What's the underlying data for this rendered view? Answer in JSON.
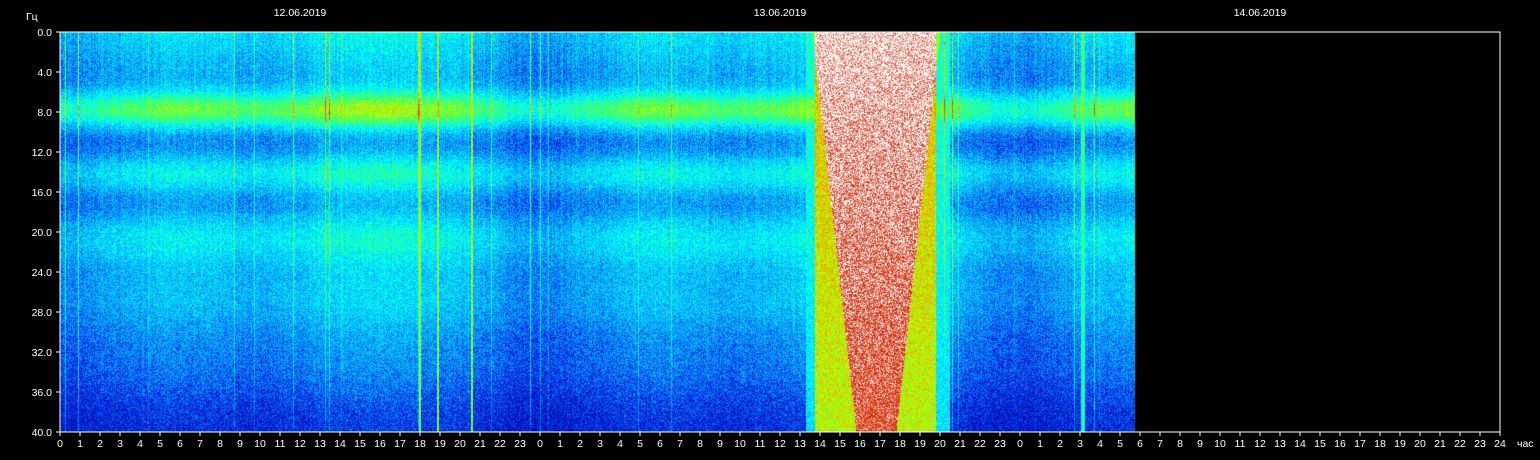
{
  "chart_data": {
    "type": "heatmap",
    "ylabel": "Гц",
    "xlabel": "час",
    "y_ticks": [
      "0.0",
      "4.0",
      "8.0",
      "12.0",
      "16.0",
      "20.0",
      "24.0",
      "28.0",
      "32.0",
      "36.0",
      "40.0"
    ],
    "ylim": [
      0,
      40
    ],
    "x_ticks": [
      "0",
      "1",
      "2",
      "3",
      "4",
      "5",
      "6",
      "7",
      "8",
      "9",
      "10",
      "11",
      "12",
      "13",
      "14",
      "15",
      "16",
      "17",
      "18",
      "19",
      "20",
      "21",
      "22",
      "23",
      "0",
      "1",
      "2",
      "3",
      "4",
      "5",
      "6",
      "7",
      "8",
      "9",
      "10",
      "11",
      "12",
      "13",
      "14",
      "15",
      "16",
      "17",
      "18",
      "19",
      "20",
      "21",
      "22",
      "23",
      "0",
      "1",
      "2",
      "3",
      "4",
      "5",
      "6",
      "7",
      "8",
      "9",
      "10",
      "11",
      "12",
      "13",
      "14",
      "15",
      "16",
      "17",
      "18",
      "19",
      "20",
      "21",
      "22",
      "23",
      "24"
    ],
    "xlim_hours": [
      0,
      72
    ],
    "dates": [
      {
        "label": "12.06.2019",
        "hour": 12
      },
      {
        "label": "13.06.2019",
        "hour": 36
      },
      {
        "label": "14.06.2019",
        "hour": 60
      }
    ],
    "data_end_hour": 53.7,
    "intensity_colormap": [
      "#000080",
      "#0020e0",
      "#00a0ff",
      "#00ffff",
      "#40ff60",
      "#c0ff00",
      "#ff8000",
      "#d02000",
      "#ffffff"
    ],
    "background": "#000000"
  }
}
